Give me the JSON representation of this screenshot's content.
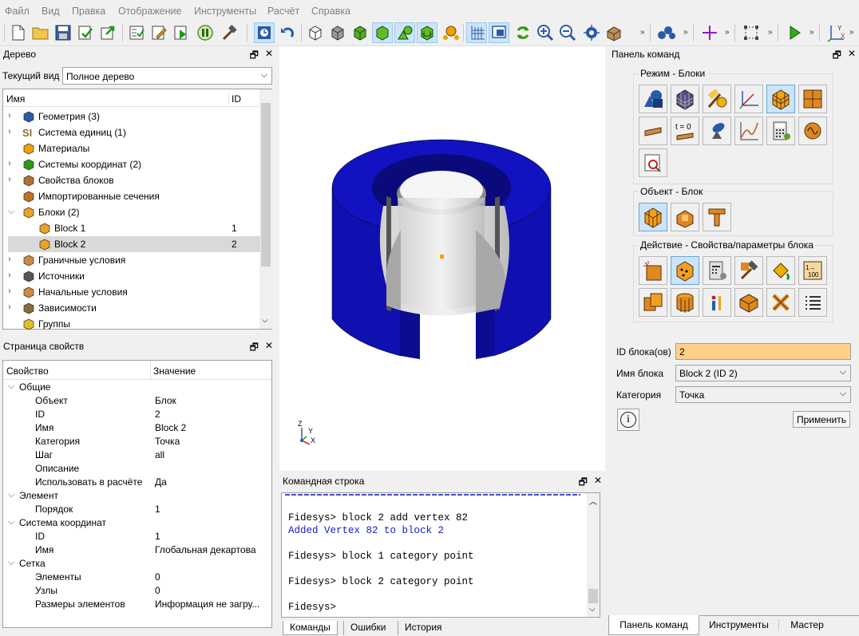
{
  "menu": [
    "Файл",
    "Вид",
    "Правка",
    "Отображение",
    "Инструменты",
    "Расчёт",
    "Справка"
  ],
  "tree_panel": {
    "title": "Дерево",
    "view_label": "Текущий вид",
    "view_value": "Полное дерево",
    "col_name": "Имя",
    "col_id": "ID",
    "items": [
      {
        "label": "Геометрия (3)",
        "id": "",
        "icon": "geometry-icon"
      },
      {
        "label": "Система единиц (1)",
        "id": "",
        "icon": "units-si-icon"
      },
      {
        "label": "Материалы",
        "id": "",
        "icon": "materials-icon"
      },
      {
        "label": "Системы координат (2)",
        "id": "",
        "icon": "coord-systems-icon"
      },
      {
        "label": "Свойства блоков",
        "id": "",
        "icon": "block-props-icon"
      },
      {
        "label": "Импортированные сечения",
        "id": "",
        "icon": "sections-icon"
      },
      {
        "label": "Блоки (2)",
        "id": "",
        "icon": "blocks-icon"
      },
      {
        "label": "Block 1",
        "id": "1",
        "icon": "block-icon"
      },
      {
        "label": "Block 2",
        "id": "2",
        "icon": "block-icon"
      },
      {
        "label": "Граничные условия",
        "id": "",
        "icon": "boundary-icon"
      },
      {
        "label": "Источники",
        "id": "",
        "icon": "sources-icon"
      },
      {
        "label": "Начальные условия",
        "id": "",
        "icon": "initial-icon"
      },
      {
        "label": "Зависимости",
        "id": "",
        "icon": "dependencies-icon"
      },
      {
        "label": "Группы",
        "id": "",
        "icon": "groups-icon"
      }
    ]
  },
  "props_panel": {
    "title": "Страница свойств",
    "col_prop": "Свойство",
    "col_value": "Значение",
    "rows": [
      {
        "k": "Общие",
        "v": "",
        "level": 0
      },
      {
        "k": "Объект",
        "v": "Блок",
        "level": 1
      },
      {
        "k": "ID",
        "v": "2",
        "level": 1
      },
      {
        "k": "Имя",
        "v": "Block 2",
        "level": 1
      },
      {
        "k": "Категория",
        "v": "Точка",
        "level": 1
      },
      {
        "k": "Шаг",
        "v": "all",
        "level": 1
      },
      {
        "k": "Описание",
        "v": "",
        "level": 1
      },
      {
        "k": "Использовать в расчёте",
        "v": "Да",
        "level": 1
      },
      {
        "k": "Элемент",
        "v": "",
        "level": 0
      },
      {
        "k": "Порядок",
        "v": "1",
        "level": 1
      },
      {
        "k": "Система координат",
        "v": "",
        "level": 0
      },
      {
        "k": "ID",
        "v": "1",
        "level": 1
      },
      {
        "k": "Имя",
        "v": "Глобальная декартова",
        "level": 1
      },
      {
        "k": "Сетка",
        "v": "",
        "level": 0
      },
      {
        "k": "Элементы",
        "v": "0",
        "level": 1
      },
      {
        "k": "Узлы",
        "v": "0",
        "level": 1
      },
      {
        "k": "Размеры элементов",
        "v": "Информация не загру...",
        "level": 1
      }
    ]
  },
  "viewport": {
    "axes": {
      "z": "Z",
      "y": "Y",
      "x": "X"
    }
  },
  "console": {
    "title": "Командная строка",
    "lines": [
      {
        "text": "Fidesys> block 2 add vertex 82",
        "kind": "cmd"
      },
      {
        "text": "Added Vertex 82 to block 2",
        "kind": "out"
      },
      {
        "text": "",
        "kind": "cmd"
      },
      {
        "text": "Fidesys> block 1 category point",
        "kind": "cmd"
      },
      {
        "text": "",
        "kind": "cmd"
      },
      {
        "text": "Fidesys> block 2 category point",
        "kind": "cmd"
      },
      {
        "text": "",
        "kind": "cmd"
      },
      {
        "text": "Fidesys>",
        "kind": "cmd"
      }
    ],
    "tabs": [
      "Команды",
      "Ошибки",
      "История"
    ]
  },
  "command_panel": {
    "title": "Панель команд",
    "group_mode": "Режим - Блоки",
    "group_object": "Объект - Блок",
    "group_action": "Действие - Свойства/параметры блока",
    "t0_label": "t = 0",
    "io_label": "1→100",
    "form": {
      "block_id_label": "ID блока(ов)",
      "block_id_value": "2",
      "block_name_label": "Имя блока",
      "block_name_value": "Block 2 (ID 2)",
      "category_label": "Категория",
      "category_value": "Точка",
      "apply_label": "Применить",
      "info_label": "i"
    },
    "tabs": [
      "Панель команд",
      "Инструменты",
      "Мастер"
    ]
  },
  "colors": {
    "accent": "#0078d7",
    "selection": "#cce4f7",
    "highlight_field": "#ffd08a",
    "model_blue": "#1010b0",
    "console_blue": "#1a1ad0"
  }
}
